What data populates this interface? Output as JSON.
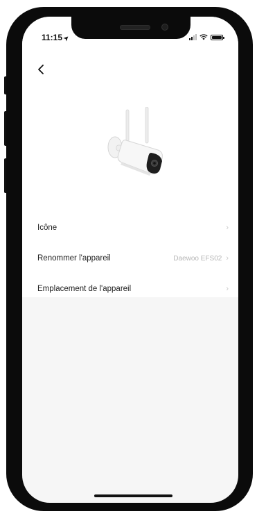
{
  "status_bar": {
    "time": "11:15",
    "location_arrow": "➤"
  },
  "navigation": {
    "back_icon": "chevron-left-icon"
  },
  "device": {
    "image_alt": "outdoor-camera-image"
  },
  "settings": {
    "items": [
      {
        "label": "Icône",
        "value": "",
        "chevron": "›"
      },
      {
        "label": "Renommer l'appareil",
        "value": "Daewoo EFS02",
        "chevron": "›"
      },
      {
        "label": "Emplacement de l'appareil",
        "value": "",
        "chevron": "›"
      }
    ]
  },
  "colors": {
    "screen_background": "#f6f6f6",
    "card_background": "#ffffff",
    "label_text": "#222222",
    "value_text": "#b5b5b5",
    "phone_frame": "#0b0b0b"
  }
}
